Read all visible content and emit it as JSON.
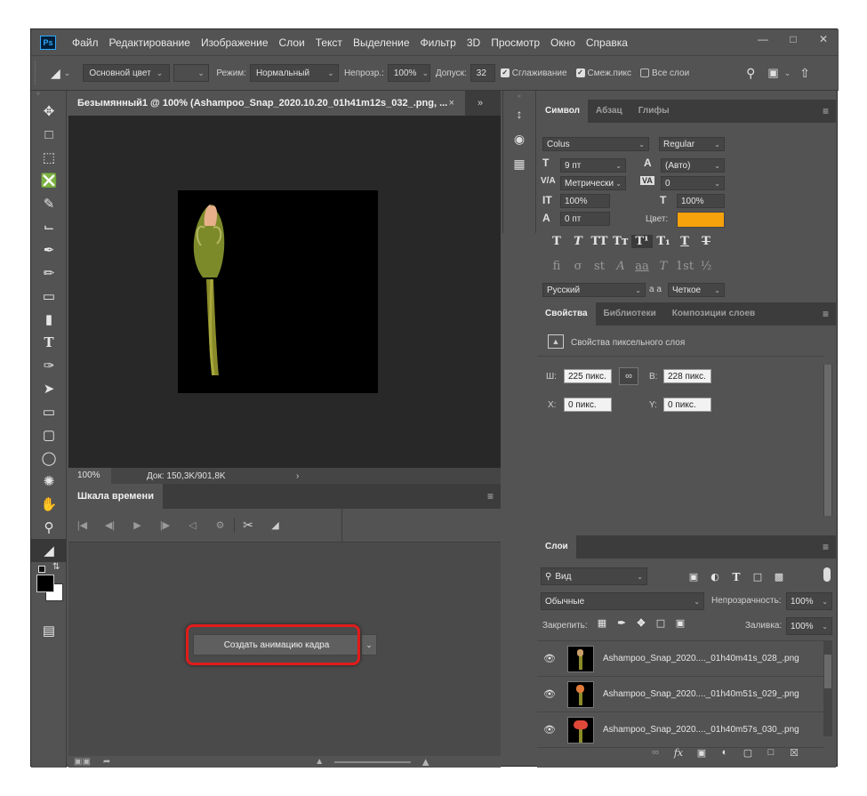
{
  "app": {
    "logo": "Ps",
    "accent": "#31a8ff",
    "highlight": "#e11b1b",
    "swatch": "#f7a20a"
  },
  "menu": [
    "Файл",
    "Редактирование",
    "Изображение",
    "Слои",
    "Текст",
    "Выделение",
    "Фильтр",
    "3D",
    "Просмотр",
    "Окно",
    "Справка"
  ],
  "window_buttons": {
    "minimize": "—",
    "restore": "□",
    "close": "✕"
  },
  "options": {
    "fill_source": "Основной цвет",
    "mode_label": "Режим:",
    "mode_value": "Нормальный",
    "opacity_label": "Непрозр.:",
    "opacity_value": "100%",
    "tolerance_label": "Допуск:",
    "tolerance_value": "32",
    "antialias_label": "Сглаживание",
    "contiguous_label": "Смеж.пикс",
    "all_layers_label": "Все слои"
  },
  "document": {
    "tab_title": "Безымянный1 @ 100% (Ashampoo_Snap_2020.10.20_01h41m12s_032_.png, ...",
    "zoom": "100%",
    "doc_info": "Док: 150,3K/901,8K"
  },
  "timeline": {
    "title": "Шкала времени",
    "create_button": "Создать анимацию кадра"
  },
  "character": {
    "tabs": [
      "Символ",
      "Абзац",
      "Глифы"
    ],
    "font_family": "Colus",
    "font_style": "Regular",
    "size": "9 пт",
    "leading": "(Авто)",
    "kerning": "Метрически",
    "tracking": "0",
    "vscale": "100%",
    "hscale": "100%",
    "baseline": "0 пт",
    "color_label": "Цвет:",
    "language": "Русский",
    "aa_label": "a a",
    "antialias": "Четкое"
  },
  "properties": {
    "tabs": [
      "Свойства",
      "Библиотеки",
      "Композиции слоев"
    ],
    "subtitle": "Свойства пиксельного слоя",
    "w_label": "Ш:",
    "w_value": "225 пикс.",
    "h_label": "В:",
    "h_value": "228 пикс.",
    "x_label": "X:",
    "x_value": "0 пикс.",
    "y_label": "Y:",
    "y_value": "0 пикс."
  },
  "layers": {
    "title": "Слои",
    "filter": "Вид",
    "blend": "Обычные",
    "opacity_label": "Непрозрачность:",
    "opacity_value": "100%",
    "lock_label": "Закрепить:",
    "fill_label": "Заливка:",
    "fill_value": "100%",
    "items": [
      {
        "name": "Ashampoo_Snap_2020...._01h40m41s_028_.png"
      },
      {
        "name": "Ashampoo_Snap_2020...._01h40m51s_029_.png"
      },
      {
        "name": "Ashampoo_Snap_2020...._01h40m57s_030_.png"
      }
    ]
  }
}
